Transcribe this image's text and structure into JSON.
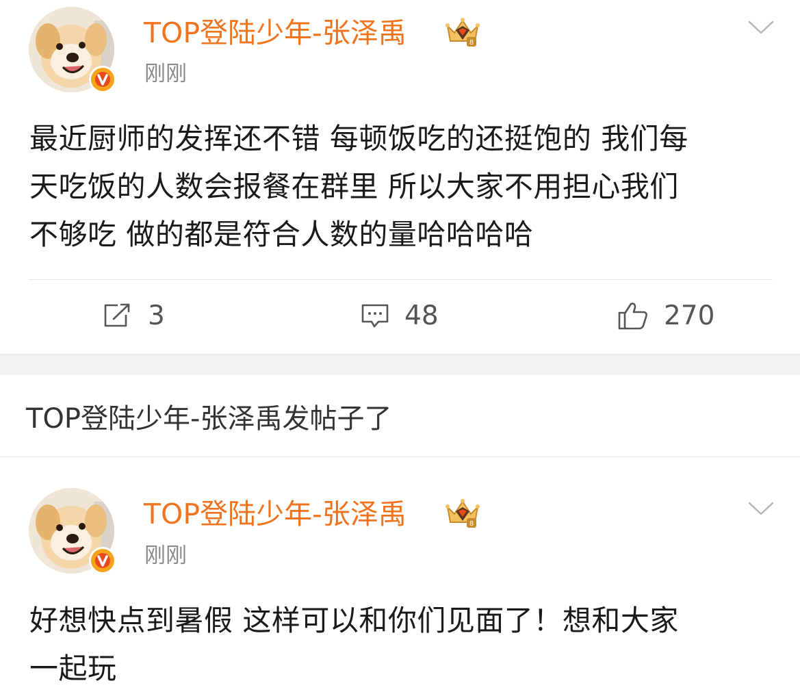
{
  "posts": [
    {
      "username": "TOP登陆少年-张泽禹",
      "timestamp": "刚刚",
      "content_lines": [
        "最近厨师的发挥还不错 每顿饭吃的还挺饱的 我们每",
        "天吃饭的人数会报餐在群里 所以大家不用担心我们",
        "不够吃 做的都是符合人数的量哈哈哈哈"
      ],
      "actions": {
        "repost_count": "3",
        "comment_count": "48",
        "like_count": "270"
      }
    },
    {
      "username": "TOP登陆少年-张泽禹",
      "timestamp": "刚刚",
      "content_lines": [
        "好想快点到暑假 这样可以和你们见面了！想和大家",
        "一起玩"
      ]
    }
  ],
  "notice": "TOP登陆少年-张泽禹发帖子了",
  "icons": {
    "verified": "verified-v-badge-icon",
    "crown": "vip-crown-icon",
    "chevron": "chevron-down-icon",
    "repost": "repost-icon",
    "comment": "comment-icon",
    "like": "thumbs-up-icon"
  },
  "colors": {
    "username": "#f0741e",
    "verified_badge": "#f7a21b",
    "timestamp": "#8a8a8a",
    "content": "#1a1a1a",
    "band": "#f1f1f1"
  }
}
